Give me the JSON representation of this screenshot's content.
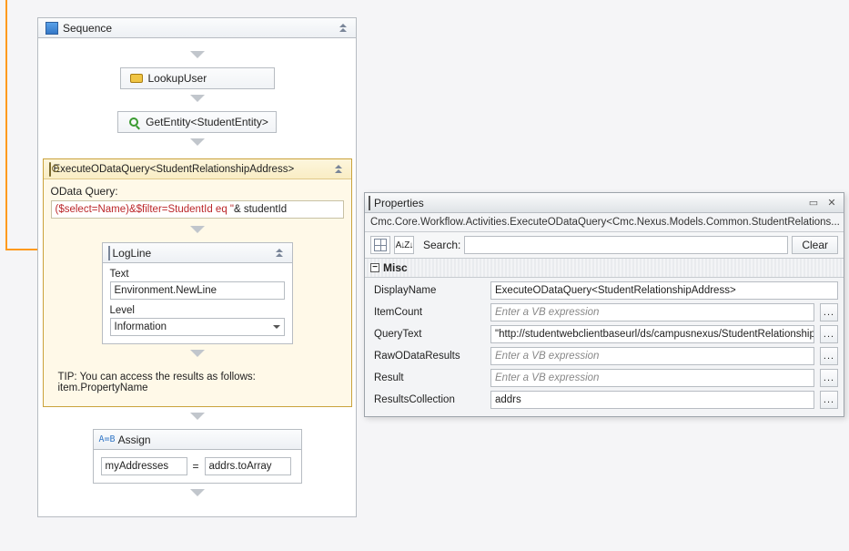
{
  "sequence": {
    "title": "Sequence",
    "lookup": {
      "label": "LookupUser"
    },
    "getentity": {
      "label": "GetEntity<StudentEntity>"
    },
    "odata": {
      "title": "ExecuteODataQuery<StudentRelationshipAddress>",
      "query_label": "OData Query:",
      "query_expr_red": "($select=Name)&$filter=StudentId eq \"",
      "query_expr_tail": " & studentId",
      "tip": "TIP: You can access the results as follows: item.PropertyName"
    },
    "logline": {
      "title": "LogLine",
      "text_label": "Text",
      "text_value": "Environment.NewLine",
      "level_label": "Level",
      "level_value": "Information"
    },
    "assign": {
      "title": "Assign",
      "lhs": "myAddresses",
      "rhs": "addrs.toArray"
    }
  },
  "properties": {
    "title": "Properties",
    "subtitle": "Cmc.Core.Workflow.Activities.ExecuteODataQuery<Cmc.Nexus.Models.Common.StudentRelations...",
    "search_label": "Search:",
    "clear_label": "Clear",
    "category": "Misc",
    "rows": {
      "displayName": {
        "label": "DisplayName",
        "value": "ExecuteODataQuery<StudentRelationshipAddress>",
        "placeholder": ""
      },
      "itemCount": {
        "label": "ItemCount",
        "value": "",
        "placeholder": "Enter a VB expression"
      },
      "queryText": {
        "label": "QueryText",
        "value": "\"http://studentwebclientbaseurl/ds/campusnexus/StudentRelationshipAc",
        "placeholder": ""
      },
      "rawODataResults": {
        "label": "RawODataResults",
        "value": "",
        "placeholder": "Enter a VB expression"
      },
      "result": {
        "label": "Result",
        "value": "",
        "placeholder": "Enter a VB expression"
      },
      "resultsCollection": {
        "label": "ResultsCollection",
        "value": "addrs",
        "placeholder": ""
      }
    },
    "sort_glyph": "A↓Z↓"
  }
}
